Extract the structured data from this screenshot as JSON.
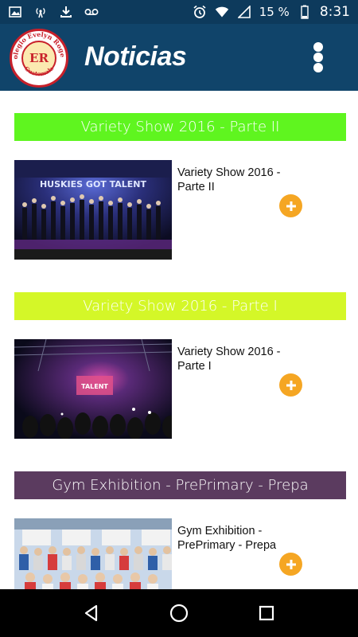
{
  "status_bar": {
    "battery": "15 %",
    "time": "8:31",
    "icons": [
      "image-icon",
      "download-icon",
      "voicemail-icon",
      "signal-icon",
      "alarm-icon",
      "wifi-icon",
      "battery-icon",
      "cellular-icon"
    ]
  },
  "app_bar": {
    "title": "Noticias",
    "logo_text": "ER",
    "logo_ring_top": "Colegio Evelyn Rogers",
    "logo_ring_bottom": "Guatemala"
  },
  "news": [
    {
      "header": "Variety Show 2016 - Parte II",
      "header_color": "#5ff51f",
      "title": "Variety Show 2016 - Parte II",
      "thumb_overlay": "HUSKIES GOT TALENT"
    },
    {
      "header": "Variety Show 2016 - Parte I",
      "header_color": "#d4f728",
      "title": "Variety Show 2016 - Parte I",
      "thumb_overlay": "TALENT"
    },
    {
      "header": "Gym Exhibition - PrePrimary - Prepa",
      "header_color": "#5b3b5f",
      "title": "Gym Exhibition - PrePrimary - Prepa",
      "thumb_overlay": ""
    }
  ],
  "colors": {
    "status_bar": "#0d3a5c",
    "app_bar": "#10446a",
    "accent": "#f5a623"
  }
}
